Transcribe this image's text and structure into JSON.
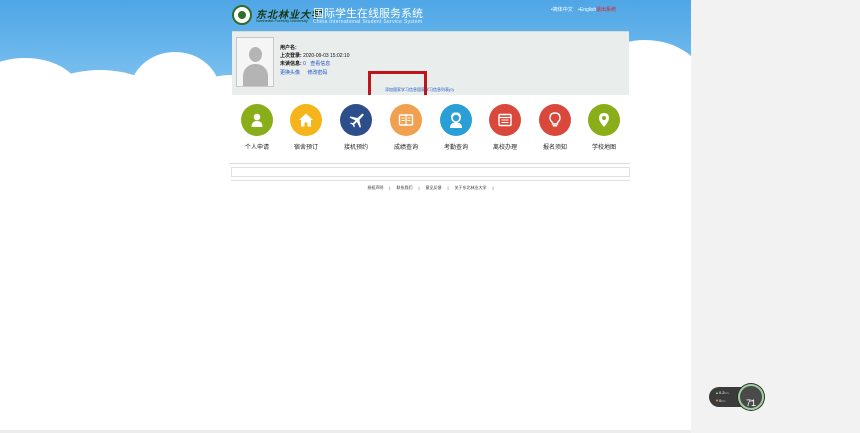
{
  "header": {
    "logo_cn": "东北林业大学",
    "logo_en": "Northeast Forestry University",
    "title": "国际学生在线服务系统",
    "subtitle": "China International Student Service System",
    "lang_cn": "•简体中文",
    "lang_en": "•English",
    "logout": "退出系统"
  },
  "profile": {
    "username_label": "用户名:",
    "username_value": "",
    "last_login_label": "上次登录:",
    "last_login_value": "2020-09-03 15:02:10",
    "unread_label": "未读信息:",
    "unread_count": "0",
    "view_messages": "查看信息",
    "change_avatar": "更换头像",
    "change_password": "修改密码",
    "add_study_link": "添加国家学习信息",
    "study_list_link": "国家学习信息列表(0)"
  },
  "services": [
    {
      "label": "个人申请",
      "icon": "person-icon",
      "color": "#8aae1a"
    },
    {
      "label": "宿舍预订",
      "icon": "home-icon",
      "color": "#f4b41a"
    },
    {
      "label": "接机预约",
      "icon": "airplane-icon",
      "color": "#2c4e8a"
    },
    {
      "label": "成绩查询",
      "icon": "scores-icon",
      "color": "#f0a04e"
    },
    {
      "label": "考勤查询",
      "icon": "attendance-icon",
      "color": "#2a9ed6"
    },
    {
      "label": "离校办理",
      "icon": "leave-school-icon",
      "color": "#d9483b"
    },
    {
      "label": "报名须知",
      "icon": "lightbulb-icon",
      "color": "#d9483b"
    },
    {
      "label": "学校地图",
      "icon": "map-pin-icon",
      "color": "#8aae1a"
    }
  ],
  "footer": {
    "links": [
      "授权声明",
      "联系我们",
      "意见反馈",
      "关于东北林业大学"
    ],
    "separator": "|"
  },
  "net_widget": {
    "upload": "0.2",
    "upload_unit": "K/s",
    "download": "0",
    "download_unit": "K/s",
    "percent": "71",
    "percent_unit": "%"
  }
}
